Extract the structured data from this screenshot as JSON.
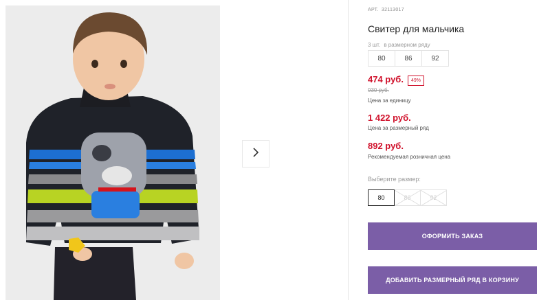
{
  "product": {
    "sku_label": "АРТ.",
    "sku": "32113017",
    "title": "Свитер для мальчика",
    "image_alt": "Свитер для мальчика"
  },
  "series": {
    "note_count": "3 шт.",
    "note_text": "в размерном ряду",
    "sizes": [
      "80",
      "86",
      "92"
    ]
  },
  "prices": {
    "unit_price": "474 руб.",
    "discount": "49%",
    "old_price": "930 руб.",
    "unit_caption": "Цена за единицу",
    "series_price": "1 422 руб.",
    "series_caption": "Цена за размерный ряд",
    "retail_price": "892 руб.",
    "retail_caption": "Рекомендуемая розничная цена"
  },
  "size_selector": {
    "label": "Выберите размер:",
    "options": [
      {
        "label": "80",
        "state": "selected"
      },
      {
        "label": "86",
        "state": "disabled"
      },
      {
        "label": "92",
        "state": "disabled"
      }
    ]
  },
  "actions": {
    "order_button": "ОФОРМИТЬ ЗАКАЗ",
    "add_series_button": "ДОБАВИТЬ РАЗМЕРНЫЙ РЯД В КОРЗИНУ"
  },
  "icons": {
    "gallery_next": "chevron-right-icon"
  },
  "colors": {
    "price_red": "#d0112b",
    "button_purple": "#7b5ea7"
  }
}
